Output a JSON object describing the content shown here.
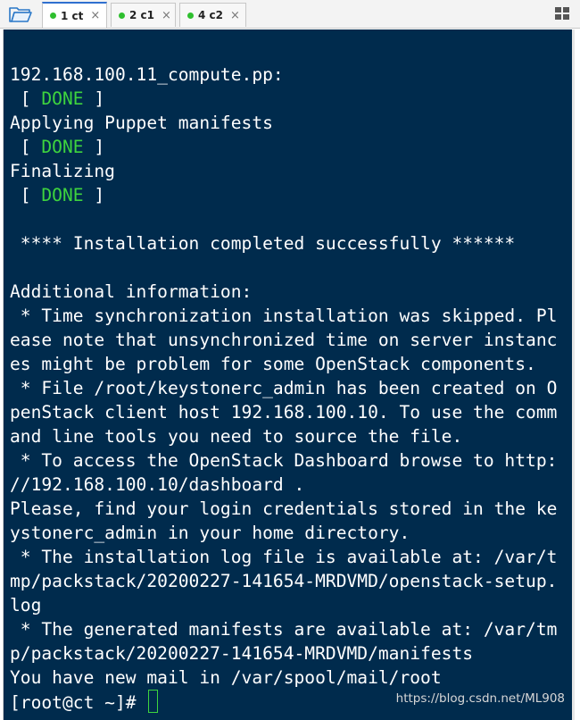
{
  "tabs": [
    {
      "label": "1 ct",
      "active": true
    },
    {
      "label": "2 c1",
      "active": false
    },
    {
      "label": "4 c2",
      "active": false
    }
  ],
  "tab_close_glyph": "×",
  "colors": {
    "terminal_bg": "#002b4d",
    "done_green": "#3ed43e",
    "tab_accent": "#2f6fcf"
  },
  "terminal": {
    "lines": [
      {
        "text": "192.168.100.11_compute.pp:"
      },
      {
        "pre": " [ ",
        "done": "DONE",
        "post": " ]"
      },
      {
        "text": "Applying Puppet manifests"
      },
      {
        "pre": " [ ",
        "done": "DONE",
        "post": " ]"
      },
      {
        "text": "Finalizing"
      },
      {
        "pre": " [ ",
        "done": "DONE",
        "post": " ]"
      },
      {
        "text": ""
      },
      {
        "text": " **** Installation completed successfully ******"
      },
      {
        "text": ""
      },
      {
        "text": "Additional information:"
      },
      {
        "text": " * Time synchronization installation was skipped. Pl"
      },
      {
        "text": "ease note that unsynchronized time on server instanc"
      },
      {
        "text": "es might be problem for some OpenStack components."
      },
      {
        "text": " * File /root/keystonerc_admin has been created on O"
      },
      {
        "text": "penStack client host 192.168.100.10. To use the comm"
      },
      {
        "text": "and line tools you need to source the file."
      },
      {
        "text": " * To access the OpenStack Dashboard browse to http:"
      },
      {
        "text": "//192.168.100.10/dashboard ."
      },
      {
        "text": "Please, find your login credentials stored in the ke"
      },
      {
        "text": "ystonerc_admin in your home directory."
      },
      {
        "text": " * The installation log file is available at: /var/t"
      },
      {
        "text": "mp/packstack/20200227-141654-MRDVMD/openstack-setup."
      },
      {
        "text": "log"
      },
      {
        "text": " * The generated manifests are available at: /var/tm"
      },
      {
        "text": "p/packstack/20200227-141654-MRDVMD/manifests"
      },
      {
        "text": "You have new mail in /var/spool/mail/root"
      }
    ],
    "prompt": "[root@ct ~]# "
  },
  "watermark": "https://blog.csdn.net/ML908",
  "icons": {
    "folder": "folder-icon",
    "layout": "grid-layout-icon",
    "status": "connection-status-dot-icon",
    "close": "close-icon"
  }
}
